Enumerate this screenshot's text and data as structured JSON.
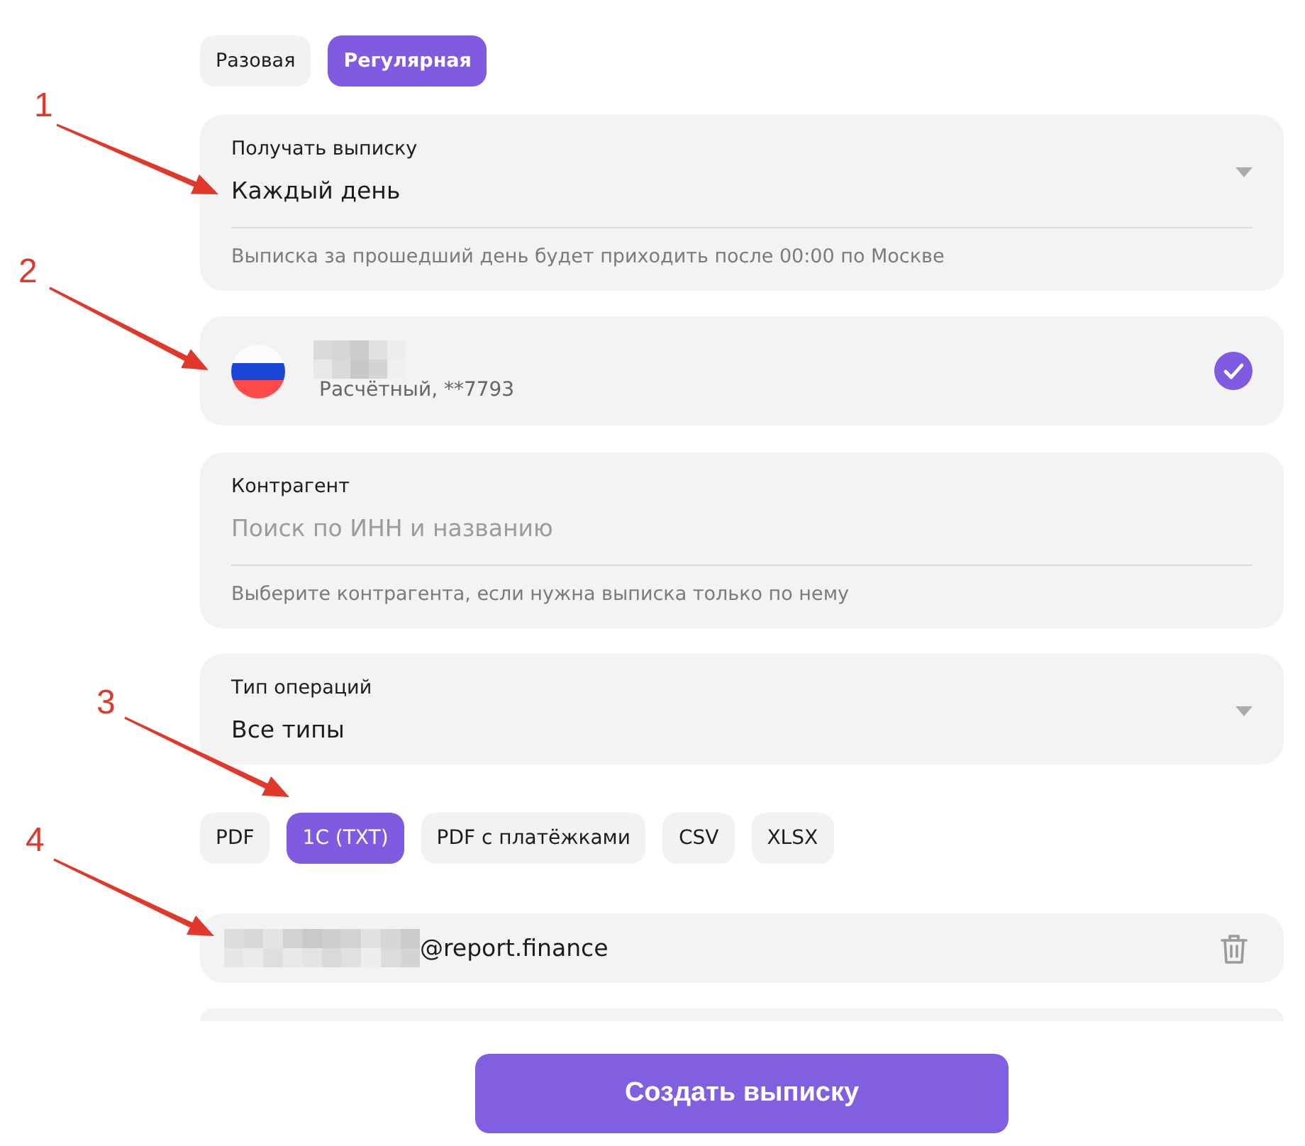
{
  "statement_type_tabs": [
    {
      "label": "Разовая",
      "selected": false
    },
    {
      "label": "Регулярная",
      "selected": true
    }
  ],
  "frequency_select": {
    "label": "Получать выписку",
    "value": "Каждый день",
    "hint": "Выписка за прошедший день будет приходить после 00:00 по Москве"
  },
  "account": {
    "name_redacted": true,
    "subtitle": "Расчётный, **7793",
    "checked": true
  },
  "counterparty_field": {
    "label": "Контрагент",
    "placeholder": "Поиск по ИНН и названию",
    "hint": "Выберите контрагента, если нужна выписка только по нему"
  },
  "operation_type_select": {
    "label": "Тип операций",
    "value": "Все типы"
  },
  "formats": [
    {
      "label": "PDF",
      "selected": false
    },
    {
      "label": "1С (TXT)",
      "selected": true
    },
    {
      "label": "PDF с платёжками",
      "selected": false
    },
    {
      "label": "CSV",
      "selected": false
    },
    {
      "label": "XLSX",
      "selected": false
    }
  ],
  "email": {
    "prefix_redacted": true,
    "domain": "@report.finance"
  },
  "create_button": {
    "label": "Создать выписку"
  },
  "annotations": [
    {
      "label": "1"
    },
    {
      "label": "2"
    },
    {
      "label": "3"
    },
    {
      "label": "4"
    }
  ]
}
